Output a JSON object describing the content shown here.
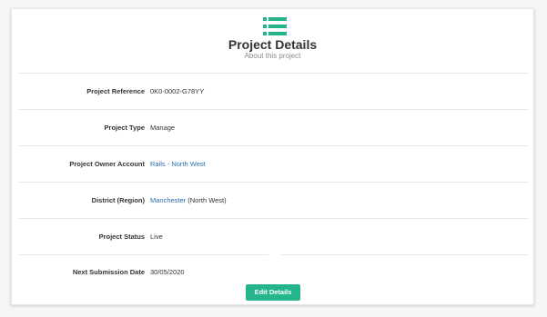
{
  "header": {
    "icon": "list-icon",
    "icon_color": "#25b58c",
    "title": "Project Details",
    "subtitle": "About this project"
  },
  "rows": [
    {
      "label": "Project Reference",
      "value": "0K0-0002-G78YY"
    },
    {
      "label": "Project Type",
      "value": "Manage"
    },
    {
      "label": "Project Owner Account",
      "value": "Rails - North West",
      "is_link": true
    },
    {
      "label": "District (Region)",
      "value_link": "Manchester",
      "value_rest": " (North West)"
    },
    {
      "label": "Project Status",
      "value": "Live"
    },
    {
      "label": "Next Submission Date",
      "value": "30/05/2020"
    }
  ],
  "actions": {
    "edit_label": "Edit Details"
  },
  "colors": {
    "accent": "#25b58c",
    "link": "#2a6db0"
  }
}
